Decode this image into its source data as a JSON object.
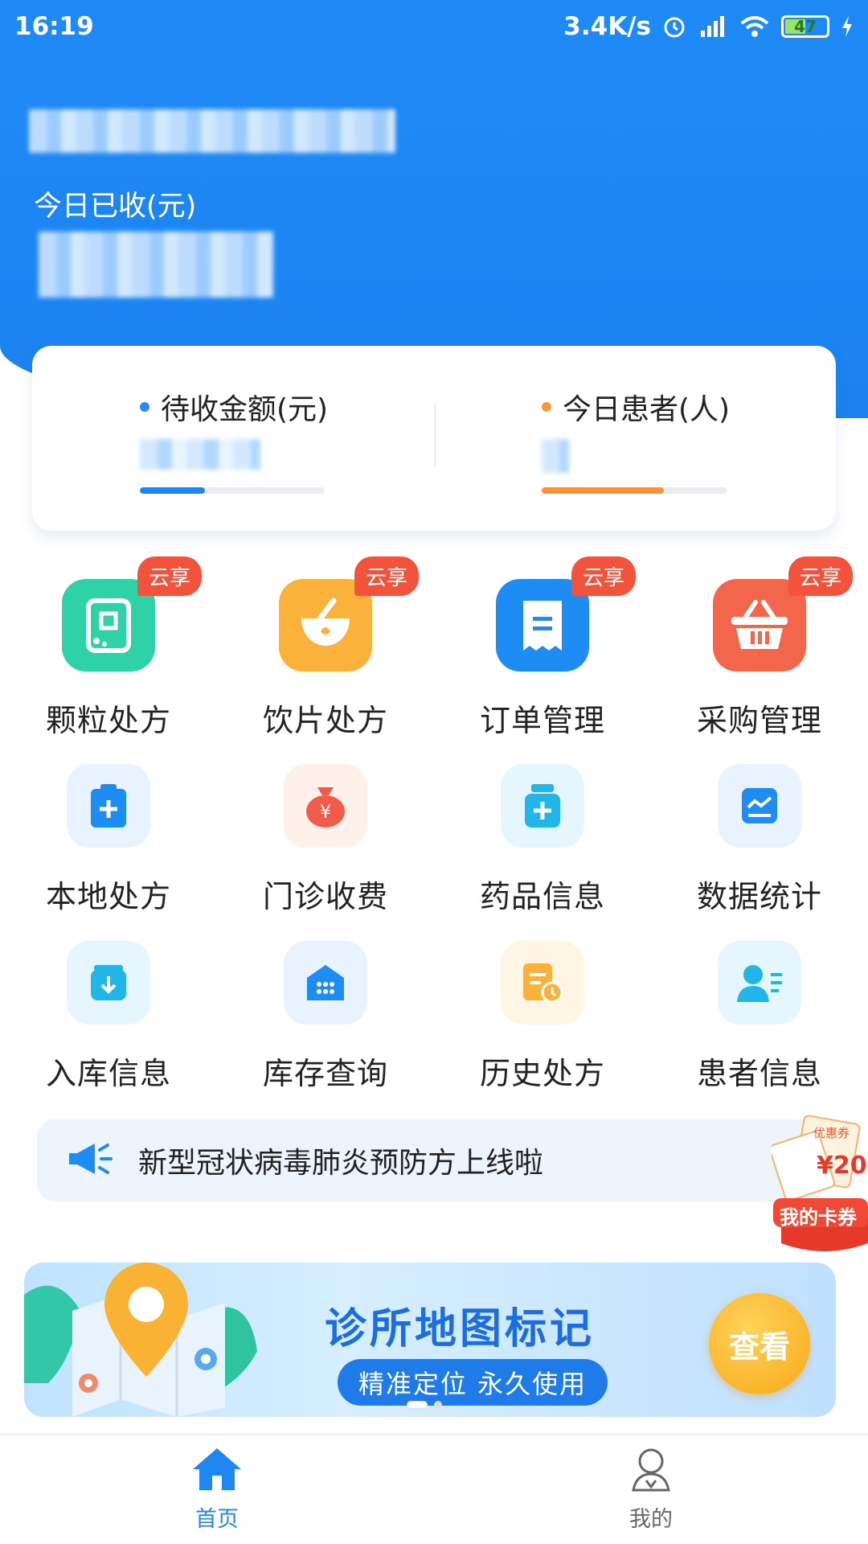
{
  "status_bar": {
    "time": "16:19",
    "net_speed": "3.4K/s",
    "battery": "47"
  },
  "summary": {
    "today_received_label": "今日已收(元)"
  },
  "stats": [
    {
      "label": "待收金额(元)",
      "dot_color": "#2a8bf2",
      "bar_color": "#1f86f2",
      "progress": 0.35
    },
    {
      "label": "今日患者(人)",
      "dot_color": "#f59a3a",
      "bar_color": "#f5923a",
      "progress": 0.66
    }
  ],
  "grid": {
    "badge_label": "云享",
    "items": [
      {
        "label": "颗粒处方",
        "icon": "granule-prescription-icon",
        "color": "#2fd1a7",
        "badge": true
      },
      {
        "label": "饮片处方",
        "icon": "herbal-mortar-icon",
        "color": "#fbb23a",
        "badge": true
      },
      {
        "label": "订单管理",
        "icon": "order-receipt-icon",
        "color": "#1e8df3",
        "badge": true
      },
      {
        "label": "采购管理",
        "icon": "shopping-basket-icon",
        "color": "#f2674c",
        "badge": true
      },
      {
        "label": "本地处方",
        "icon": "clipboard-plus-icon",
        "color": "#1e8df3",
        "badge": false
      },
      {
        "label": "门诊收费",
        "icon": "money-bag-icon",
        "color": "#f25a4a",
        "badge": false
      },
      {
        "label": "药品信息",
        "icon": "medicine-bottle-icon",
        "color": "#22b6e8",
        "badge": false
      },
      {
        "label": "数据统计",
        "icon": "chart-icon",
        "color": "#1e8df3",
        "badge": false
      },
      {
        "label": "入库信息",
        "icon": "inbox-download-icon",
        "color": "#22b6e8",
        "badge": false
      },
      {
        "label": "库存查询",
        "icon": "warehouse-icon",
        "color": "#1e8df3",
        "badge": false
      },
      {
        "label": "历史处方",
        "icon": "history-document-icon",
        "color": "#fbb23a",
        "badge": false
      },
      {
        "label": "患者信息",
        "icon": "patient-icon",
        "color": "#22b6e8",
        "badge": false
      }
    ]
  },
  "notice": {
    "text": "新型冠状病毒肺炎预防方上线啦"
  },
  "coupon": {
    "tag": "优惠券",
    "amount": "¥20",
    "caption": "我的卡券"
  },
  "banner": {
    "title": "诊所地图标记",
    "subtitle": "精准定位 永久使用",
    "button": "查看"
  },
  "tabbar": {
    "items": [
      {
        "label": "首页",
        "active": true
      },
      {
        "label": "我的",
        "active": false
      }
    ],
    "active_color": "#1f86f2",
    "inactive_color": "#666666"
  }
}
